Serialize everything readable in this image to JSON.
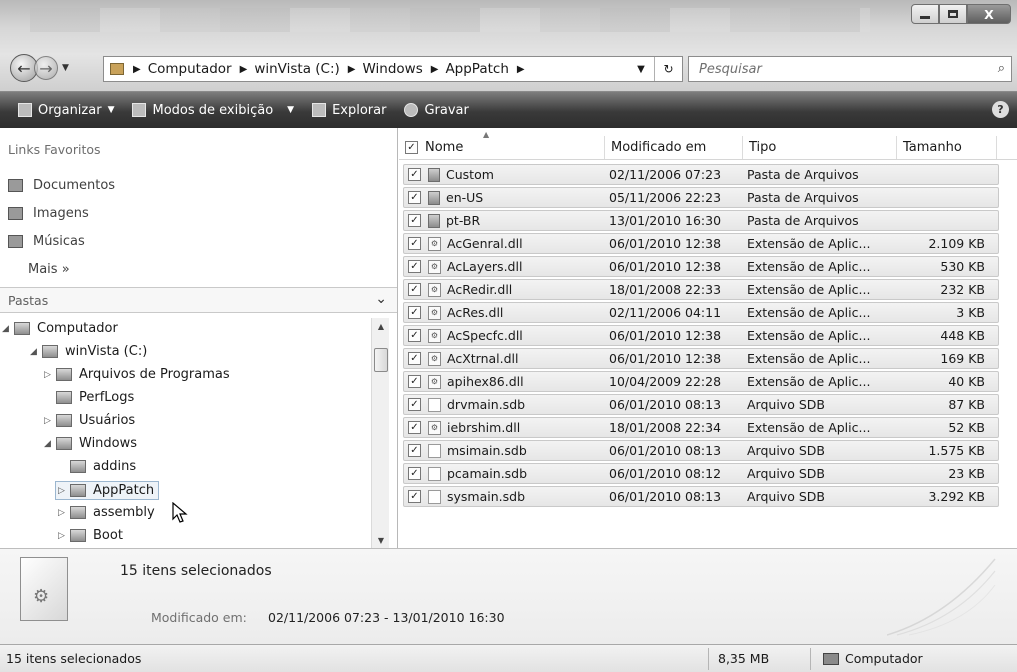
{
  "window": {
    "minimize_icon": "minimize-icon",
    "maximize_icon": "maximize-icon",
    "close_label": "X"
  },
  "address": {
    "crumbs": [
      "Computador",
      "winVista (C:)",
      "Windows",
      "AppPatch"
    ],
    "search_placeholder": "Pesquisar"
  },
  "toolbar": {
    "organize": "Organizar",
    "views": "Modos de exibição",
    "explore": "Explorar",
    "burn": "Gravar",
    "help": "?"
  },
  "favorites": {
    "heading": "Links Favoritos",
    "items": [
      "Documentos",
      "Imagens",
      "Músicas"
    ],
    "more": "Mais »"
  },
  "folders": {
    "heading": "Pastas",
    "tree": [
      "Computador",
      "winVista (C:)",
      "Arquivos de Programas",
      "PerfLogs",
      "Usuários",
      "Windows",
      "addins",
      "AppPatch",
      "assembly",
      "Boot"
    ]
  },
  "columns": {
    "name": "Nome",
    "modified": "Modificado em",
    "type": "Tipo",
    "size": "Tamanho"
  },
  "files": [
    {
      "name": "Custom",
      "modified": "02/11/2006 07:23",
      "type": "Pasta de Arquivos",
      "size": "",
      "icon": "folder"
    },
    {
      "name": "en-US",
      "modified": "05/11/2006 22:23",
      "type": "Pasta de Arquivos",
      "size": "",
      "icon": "folder"
    },
    {
      "name": "pt-BR",
      "modified": "13/01/2010 16:30",
      "type": "Pasta de Arquivos",
      "size": "",
      "icon": "folder"
    },
    {
      "name": "AcGenral.dll",
      "modified": "06/01/2010 12:38",
      "type": "Extensão de Aplic...",
      "size": "2.109 KB",
      "icon": "dll"
    },
    {
      "name": "AcLayers.dll",
      "modified": "06/01/2010 12:38",
      "type": "Extensão de Aplic...",
      "size": "530 KB",
      "icon": "dll"
    },
    {
      "name": "AcRedir.dll",
      "modified": "18/01/2008 22:33",
      "type": "Extensão de Aplic...",
      "size": "232 KB",
      "icon": "dll"
    },
    {
      "name": "AcRes.dll",
      "modified": "02/11/2006 04:11",
      "type": "Extensão de Aplic...",
      "size": "3 KB",
      "icon": "dll"
    },
    {
      "name": "AcSpecfc.dll",
      "modified": "06/01/2010 12:38",
      "type": "Extensão de Aplic...",
      "size": "448 KB",
      "icon": "dll"
    },
    {
      "name": "AcXtrnal.dll",
      "modified": "06/01/2010 12:38",
      "type": "Extensão de Aplic...",
      "size": "169 KB",
      "icon": "dll"
    },
    {
      "name": "apihex86.dll",
      "modified": "10/04/2009 22:28",
      "type": "Extensão de Aplic...",
      "size": "40 KB",
      "icon": "dll"
    },
    {
      "name": "drvmain.sdb",
      "modified": "06/01/2010 08:13",
      "type": "Arquivo SDB",
      "size": "87 KB",
      "icon": "doc"
    },
    {
      "name": "iebrshim.dll",
      "modified": "18/01/2008 22:34",
      "type": "Extensão de Aplic...",
      "size": "52 KB",
      "icon": "dll"
    },
    {
      "name": "msimain.sdb",
      "modified": "06/01/2010 08:13",
      "type": "Arquivo SDB",
      "size": "1.575 KB",
      "icon": "doc"
    },
    {
      "name": "pcamain.sdb",
      "modified": "06/01/2010 08:12",
      "type": "Arquivo SDB",
      "size": "23 KB",
      "icon": "doc"
    },
    {
      "name": "sysmain.sdb",
      "modified": "06/01/2010 08:13",
      "type": "Arquivo SDB",
      "size": "3.292 KB",
      "icon": "doc"
    }
  ],
  "details": {
    "title": "15 itens selecionados",
    "modified_label": "Modificado em:",
    "modified_value": "02/11/2006 07:23 - 13/01/2010 16:30"
  },
  "status": {
    "left": "15 itens selecionados",
    "size": "8,35 MB",
    "location": "Computador"
  }
}
